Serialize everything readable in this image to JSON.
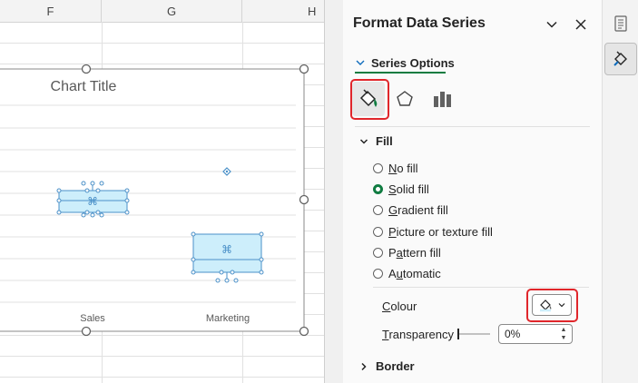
{
  "sheet": {
    "columns": [
      "F",
      "G",
      "H"
    ]
  },
  "chart": {
    "title": "Chart Title",
    "categories": [
      "Sales",
      "Marketing"
    ]
  },
  "chart_data": {
    "type": "box",
    "title": "Chart Title",
    "categories": [
      "Sales",
      "Marketing"
    ],
    "xlabel": "",
    "ylabel": "",
    "grid": true,
    "series": [
      {
        "values": []
      }
    ]
  },
  "pane": {
    "title": "Format Data Series",
    "tab_label": "Series Options",
    "fill_section": "Fill",
    "border_section": "Border",
    "fill_options": [
      {
        "label": "No fill",
        "checked": false
      },
      {
        "label": "Solid fill",
        "checked": true
      },
      {
        "label": "Gradient fill",
        "checked": false
      },
      {
        "label": "Picture or texture fill",
        "checked": false
      },
      {
        "label": "Pattern fill",
        "checked": false
      },
      {
        "label": "Automatic",
        "checked": false
      }
    ],
    "colour_label": "Colour",
    "transparency_label": "Transparency",
    "transparency_value": "0%"
  },
  "icons": {
    "tab_chevron": "chevron-down-icon",
    "options_dropdown": "chevron-down-icon",
    "close": "close-icon",
    "fill_category": "paint-bucket-icon",
    "effects_category": "pentagon-icon",
    "series_category": "bar-chart-icon",
    "colour_picker": "paint-bucket-icon",
    "rail_properties": "document-icon",
    "rail_format": "paintbrush-icon"
  },
  "colors": {
    "accent": "#107c41",
    "highlight": "#e0262b",
    "box_fill": "#cdeefb",
    "box_stroke": "#4a90c8"
  }
}
